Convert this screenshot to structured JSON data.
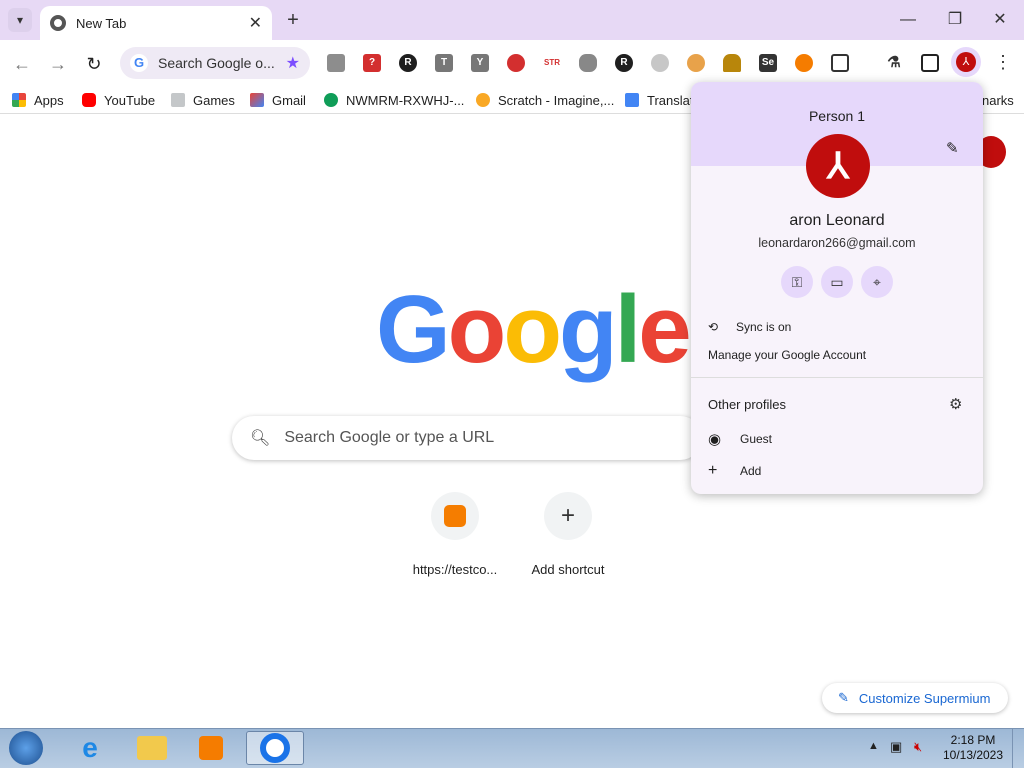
{
  "browser": {
    "tab_title": "New Tab",
    "omnibox_text": "Search Google o...",
    "window_controls": {
      "minimize": "—",
      "restore": "❐",
      "close": "✕"
    }
  },
  "extensions": [
    "gimp-icon",
    "puzzle-red-icon",
    "r-icon",
    "t-icon",
    "y-icon",
    "redshape-icon",
    "str-icon",
    "database-icon",
    "r2-icon",
    "cloud-icon",
    "burger-icon",
    "pencil-icon",
    "se-icon",
    "ball-icon",
    "extensions-icon",
    "flask-icon",
    "sidepanel-icon",
    "profile-avatar-icon",
    "menu-icon"
  ],
  "bookmarks": [
    {
      "label": "Apps",
      "icon": "apps-grid-icon",
      "color": "#e8453c"
    },
    {
      "label": "YouTube",
      "icon": "youtube-icon",
      "color": "#ff0000"
    },
    {
      "label": "Games",
      "icon": "games-icon",
      "color": "#9aa0a6"
    },
    {
      "label": "Gmail",
      "icon": "gmail-icon",
      "color": "#ea4335"
    },
    {
      "label": "NWMRM-RXWHJ-...",
      "icon": "phone-icon",
      "color": "#0f9d58"
    },
    {
      "label": "Scratch - Imagine,...",
      "icon": "scratch-icon",
      "color": "#f9a825"
    },
    {
      "label": "Translat",
      "icon": "translate-icon",
      "color": "#4285f4"
    },
    {
      "label": "narks",
      "icon": "",
      "color": ""
    }
  ],
  "main": {
    "logo": [
      "G",
      "o",
      "o",
      "g",
      "l",
      "e"
    ],
    "logo_colors": [
      "#4285f4",
      "#ea4335",
      "#fbbc05",
      "#4285f4",
      "#34a853",
      "#ea4335"
    ],
    "search_placeholder": "Search Google or type a URL",
    "shortcuts": [
      {
        "label": "https://testco...",
        "icon": "blogger-icon"
      },
      {
        "label": "Add shortcut",
        "icon": "plus-icon"
      }
    ],
    "customize_label": "Customize Supermium"
  },
  "profile_popup": {
    "profile_label": "Person 1",
    "name": "aron Leonard",
    "email": "leonardaron266@gmail.com",
    "sync_label": "Sync is on",
    "manage_label": "Manage your Google Account",
    "other_profiles_label": "Other profiles",
    "guest_label": "Guest",
    "add_label": "Add"
  },
  "taskbar": {
    "time": "2:18 PM",
    "date": "10/13/2023"
  }
}
